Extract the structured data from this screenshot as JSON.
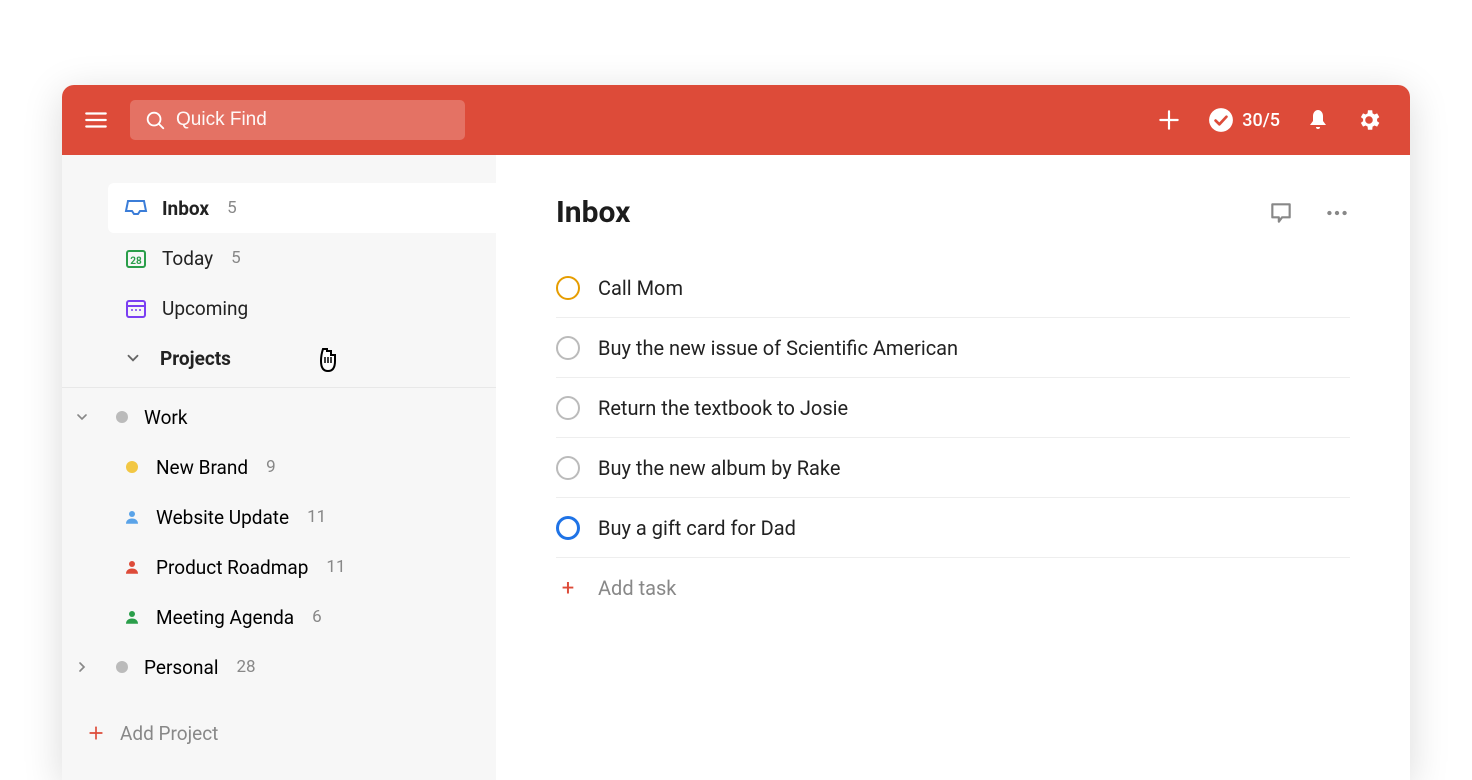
{
  "topbar": {
    "search_placeholder": "Quick Find",
    "karma": "30/5"
  },
  "sidebar": {
    "inbox": {
      "label": "Inbox",
      "count": "5",
      "today_date": "28"
    },
    "today": {
      "label": "Today",
      "count": "5"
    },
    "upcoming": {
      "label": "Upcoming"
    },
    "projects_label": "Projects",
    "work": {
      "label": "Work"
    },
    "sub": [
      {
        "label": "New Brand",
        "count": "9"
      },
      {
        "label": "Website Update",
        "count": "11"
      },
      {
        "label": "Product Roadmap",
        "count": "11"
      },
      {
        "label": "Meeting Agenda",
        "count": "6"
      }
    ],
    "personal": {
      "label": "Personal",
      "count": "28"
    },
    "add_project": "Add Project"
  },
  "main": {
    "title": "Inbox",
    "tasks": [
      {
        "title": "Call Mom",
        "priority": "p2"
      },
      {
        "title": "Buy the new issue of Scientific American",
        "priority": ""
      },
      {
        "title": "Return the textbook to Josie",
        "priority": ""
      },
      {
        "title": "Buy the new album by Rake",
        "priority": ""
      },
      {
        "title": "Buy a gift card for Dad",
        "priority": "p3"
      }
    ],
    "add_task": "Add task"
  }
}
